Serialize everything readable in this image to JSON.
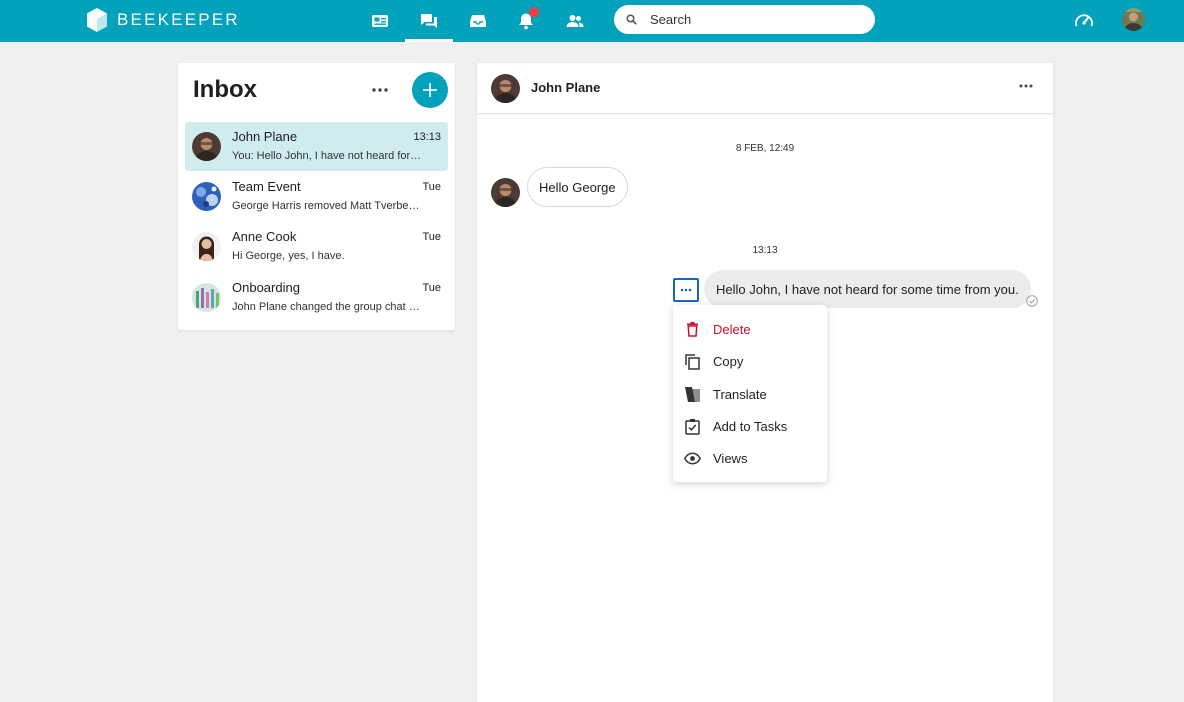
{
  "brand": {
    "name": "BEEKEEPER"
  },
  "topnav": {
    "items": [
      {
        "icon": "news-feed-icon"
      },
      {
        "icon": "chat-icon",
        "active": true
      },
      {
        "icon": "inbox-tray-icon"
      },
      {
        "icon": "bell-icon",
        "badge": true
      },
      {
        "icon": "people-icon"
      }
    ],
    "search_placeholder": "Search"
  },
  "inbox": {
    "title": "Inbox",
    "conversations": [
      {
        "name": "John Plane",
        "time": "13:13",
        "preview": "You: Hello John, I have not heard for some time from you.",
        "selected": true
      },
      {
        "name": "Team Event",
        "time": "Tue",
        "preview": "George Harris removed Matt Tverberg from the chat"
      },
      {
        "name": "Anne Cook",
        "time": "Tue",
        "preview": "Hi George, yes, I have."
      },
      {
        "name": "Onboarding",
        "time": "Tue",
        "preview": "John Plane changed the group chat name"
      }
    ]
  },
  "chat": {
    "contact_name": "John Plane",
    "messages": [
      {
        "date_separator": "8 FEB, 12:49",
        "text": "Hello George",
        "direction": "incoming"
      },
      {
        "date_separator": "13:13",
        "text": "Hello John, I have not heard for some time from you.",
        "direction": "outgoing"
      }
    ]
  },
  "context_menu": {
    "items": [
      {
        "label": "Delete",
        "icon": "trash-icon",
        "color": "#c8102e"
      },
      {
        "label": "Copy",
        "icon": "copy-icon"
      },
      {
        "label": "Translate",
        "icon": "translate-icon"
      },
      {
        "label": "Add to Tasks",
        "icon": "task-checkbox-icon"
      },
      {
        "label": "Views",
        "icon": "eye-icon"
      }
    ]
  },
  "colors": {
    "brand": "#02a1bc",
    "selected_row": "#d0ecf1",
    "danger": "#c8102e",
    "focus": "#1c64c4",
    "badge": "#ef3e4a"
  }
}
